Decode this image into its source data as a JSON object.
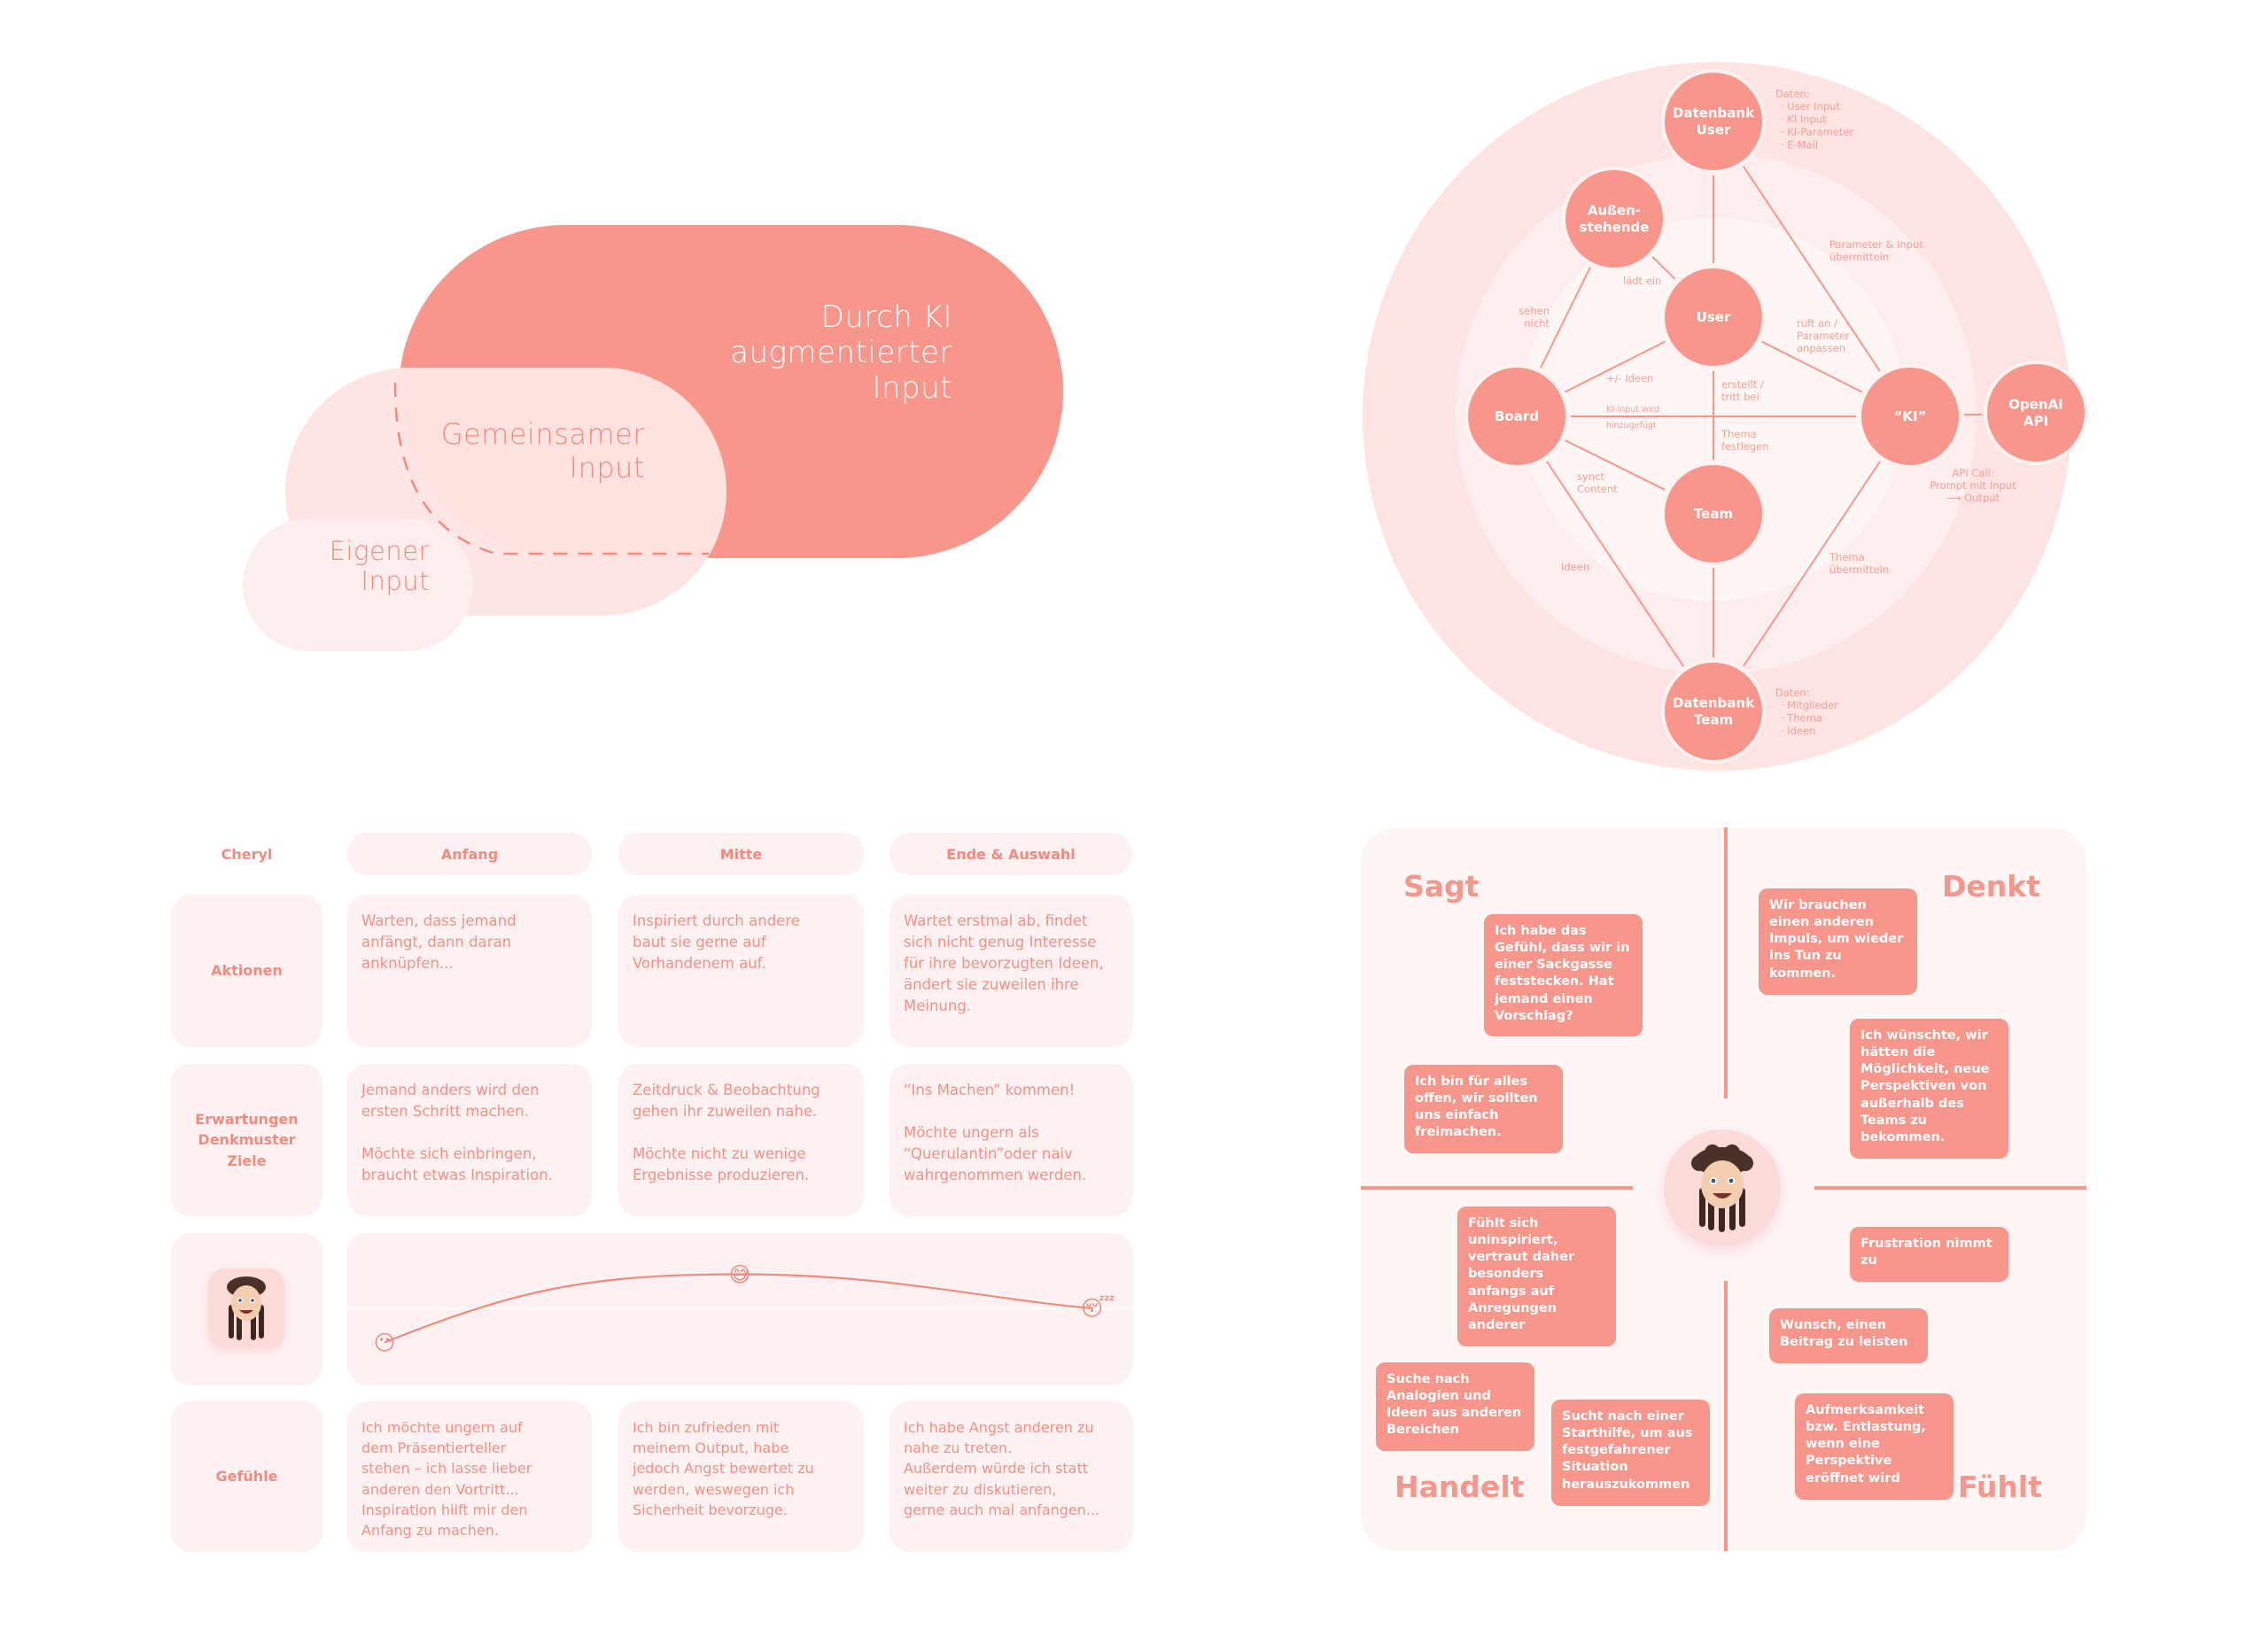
{
  "colors": {
    "accent": "#F9968C",
    "accent_text": "#F28A80",
    "annotation_text": "#F3A097",
    "cell_bg": "#FEF1F1",
    "ring_outer": "#FDE3E1",
    "ring_middle": "#FDEDEC",
    "ring_inner": "#FEF6F5",
    "white": "#FFFFFF"
  },
  "venn": {
    "ki_label": "Durch KI\naugmentierter\nInput",
    "shared_label": "Gemeinsamer\nInput",
    "own_label": "Eigener\nInput"
  },
  "network": {
    "nodes": {
      "db_user": "Datenbank|User",
      "outsiders": "Außen-|stehende",
      "user": "User",
      "board": "Board",
      "ki": "“KI”",
      "openai": "OpenAI|API",
      "team": "Team",
      "db_team": "Datenbank|Team"
    },
    "db_user_data": {
      "title": "Daten:",
      "items": [
        "User Input",
        "KI Input",
        "KI-Parameter",
        "E-Mail"
      ]
    },
    "db_team_data": {
      "title": "Daten:",
      "items": [
        "Mitglieder",
        "Thema",
        "Ideen"
      ]
    },
    "edge_labels": {
      "parameter_input": "Parameter & Input|übermitteln",
      "laedt_ein": "lädt ein",
      "sehen_nicht": "sehen|nicht",
      "ruft_an": "ruft an /|Parameter|anpassen",
      "ideen_plusminus": "+/- Ideen",
      "erstellt": "erstellt /|tritt bei",
      "ki_input_1": "KI-Input wird",
      "ki_input_2": "hinzugefügt",
      "thema_festlegen": "Thema|festlegen",
      "synct": "synct|Content",
      "api_call": "API Call:|Prompt mit Input|⟶ Output",
      "ideen": "Ideen",
      "thema_uebermitteln": "Thema|übermitteln"
    }
  },
  "journey": {
    "persona": "Cheryl",
    "phases": [
      "Anfang",
      "Mitte",
      "Ende & Auswahl"
    ],
    "rows": [
      {
        "label": "Aktionen",
        "cells": [
          "Warten, dass jemand\nanfängt, dann daran\nanknüpfen...",
          "Inspiriert durch andere\nbaut sie gerne auf\nVorhandenem auf.",
          "Wartet erstmal ab, findet\nsich nicht genug Interesse\nfür ihre bevorzugten Ideen,\nändert sie zuweilen ihre\nMeinung."
        ]
      },
      {
        "label": "Erwartungen\nDenkmuster\nZiele",
        "cells": [
          "Jemand anders wird den\nersten Schritt machen.\n\nMöchte sich einbringen,\nbraucht etwas Inspiration.",
          "Zeitdruck & Beobachtung\ngehen ihr zuweilen nahe.\n\nMöchte nicht zu wenige\nErgebnisse produzieren.",
          "“Ins Machen“ kommen!\n\nMöchte ungern als\n“Querulantin”oder naiv\nwahrgenommen werden."
        ]
      },
      {
        "label": "Gefühle",
        "cells": [
          "Ich möchte ungern auf\ndem Präsentierteller\nstehen – ich lasse lieber\nanderen den Vortritt...\nInspiration hilft mir den\nAnfang zu machen.",
          "Ich bin zufrieden mit\nmeinem Output, habe\njedoch Angst bewertet zu\nwerden, weswegen ich\nSicherheit bevorzuge.",
          "Ich habe Angst anderen zu\nnahe zu treten.\nAußerdem würde ich statt\nweiter zu diskutieren,\ngerne auch mal anfangen..."
        ]
      }
    ],
    "emotion_curve": {
      "points": [
        {
          "phase": "Anfang",
          "emoji": "😶",
          "mood": 0.15
        },
        {
          "phase": "Mitte",
          "emoji": "😅",
          "mood": 0.85
        },
        {
          "phase": "Ende & Auswahl",
          "emoji": "😴",
          "mood": 0.5
        }
      ]
    }
  },
  "empathy_map": {
    "quadrants": {
      "sagt": {
        "title": "Sagt",
        "notes": [
          "Ich habe das\nGefühl, dass wir in\neiner Sackgasse\nfeststecken. Hat\njemand einen\nVorschlag?",
          "Ich bin für alles\noffen, wir sollten\nuns einfach\nfreimachen."
        ]
      },
      "denkt": {
        "title": "Denkt",
        "notes": [
          "Wir brauchen\neinen anderen\nImpuls, um wieder\nins Tun zu\nkommen.",
          "Ich wünschte, wir\nhätten die\nMöglichkeit, neue\nPerspektiven von\naußerhalb des\nTeams zu\nbekommen."
        ]
      },
      "handelt": {
        "title": "Handelt",
        "notes": [
          "Fühlt sich\nuninspiriert,\nvertraut daher\nbesonders\nanfangs auf\nAnregungen\nanderer",
          "Suche nach\nAnalogien und\nIdeen aus anderen\nBereichen",
          "Sucht nach einer\nStarthilfe, um aus\nfestgefahrener\nSituation\nherauszukommen"
        ]
      },
      "fuehlt": {
        "title": "Fühlt",
        "notes": [
          "Frustration nimmt\nzu",
          "Wunsch, einen\nBeitrag zu leisten",
          "Aufmerksamkeit\nbzw. Entlastung,\nwenn eine\nPerspektive\neröffnet wird"
        ]
      }
    }
  }
}
